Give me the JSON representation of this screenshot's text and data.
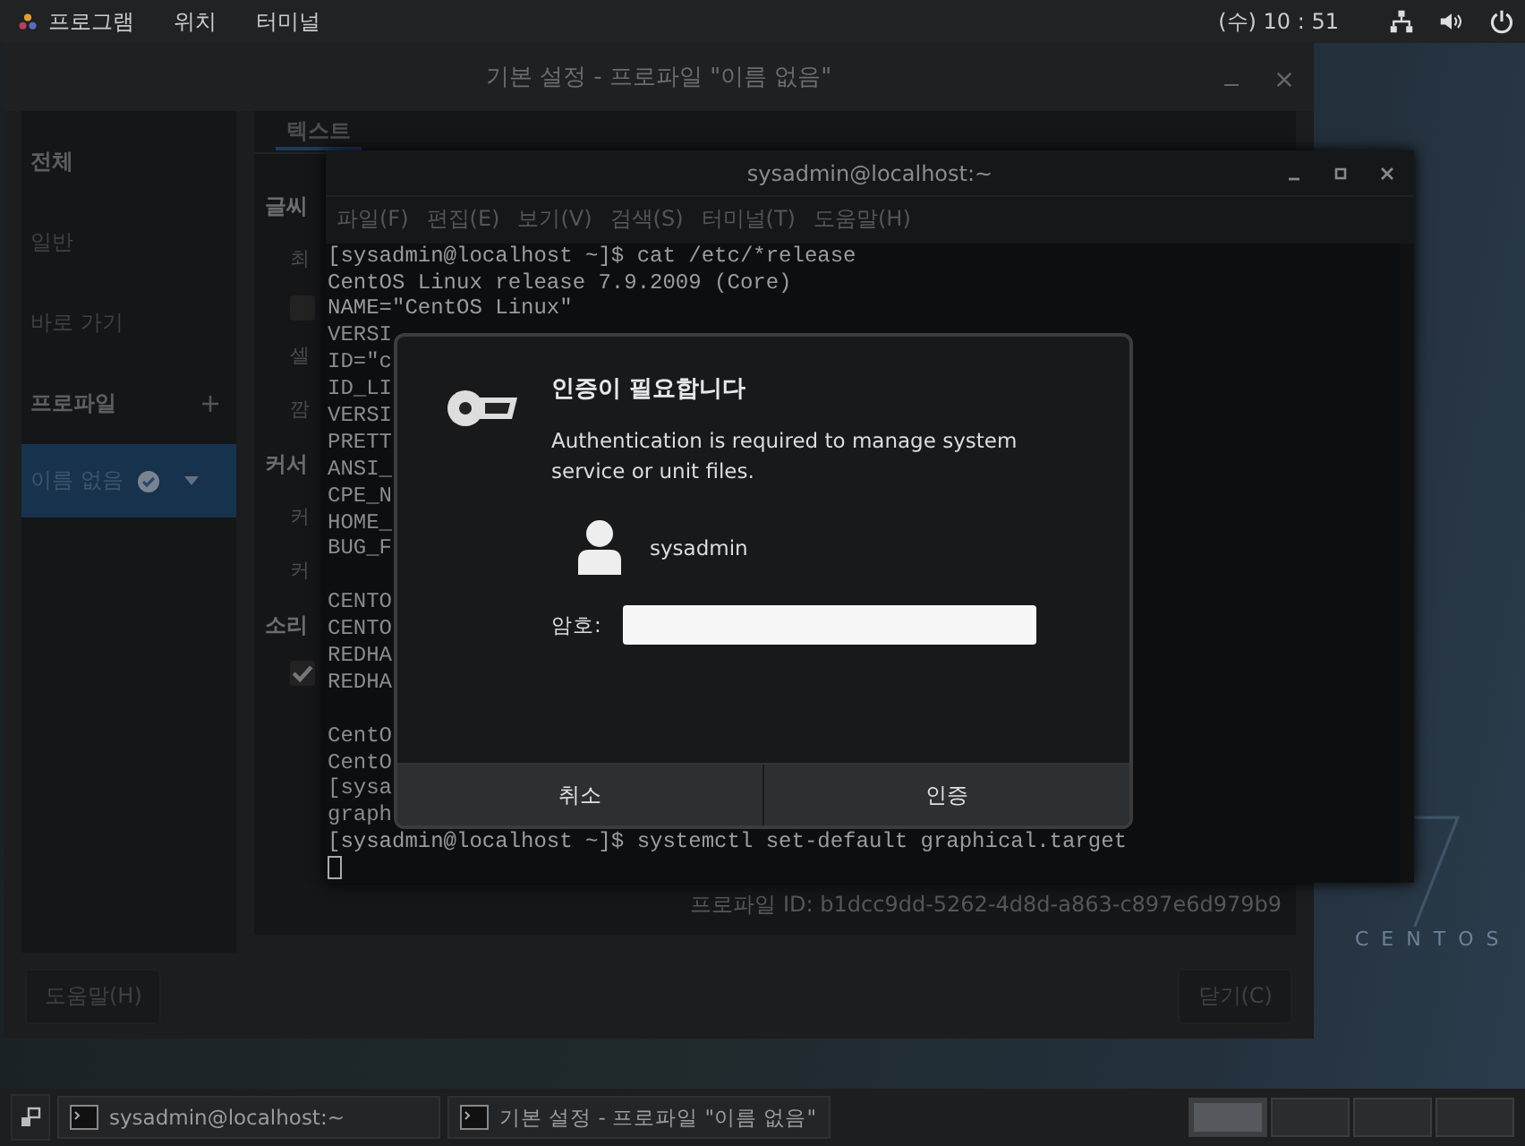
{
  "top_bar": {
    "menus": [
      "프로그램",
      "위치",
      "터미널"
    ],
    "clock": "(수) 10 : 51"
  },
  "settings_window": {
    "title": "기본 설정 - 프로파일 \"이름 없음\"",
    "sidebar": [
      {
        "kind": "header",
        "label": "전체",
        "selected": false
      },
      {
        "kind": "item",
        "label": "일반",
        "selected": false
      },
      {
        "kind": "item",
        "label": "바로 가기",
        "selected": false
      },
      {
        "kind": "header-add",
        "label": "프로파일",
        "selected": false
      },
      {
        "kind": "profile",
        "label": "이름 없음",
        "selected": true
      }
    ],
    "tabs": [
      {
        "label": "텍스트",
        "selected": true
      }
    ],
    "form_items": [
      {
        "kind": "heading",
        "text": "글씨"
      },
      {
        "kind": "label",
        "text": "최"
      },
      {
        "kind": "checkbox",
        "checked": false
      },
      {
        "kind": "label",
        "text": "셀"
      },
      {
        "kind": "label",
        "text": "깜"
      },
      {
        "kind": "heading",
        "text": "커서"
      },
      {
        "kind": "label",
        "text": "커"
      },
      {
        "kind": "label",
        "text": "커"
      },
      {
        "kind": "heading",
        "text": "소리"
      },
      {
        "kind": "checkbox",
        "checked": true
      }
    ],
    "profile_id": "프로파일 ID: b1dcc9dd-5262-4d8d-a863-c897e6d979b9",
    "help_button": "도움말(H)",
    "close_button": "닫기(C)"
  },
  "terminal_window": {
    "title": "sysadmin@localhost:~",
    "menus": [
      "파일(F)",
      "편집(E)",
      "보기(V)",
      "검색(S)",
      "터미널(T)",
      "도움말(H)"
    ],
    "lines": [
      {
        "kind": "text",
        "text": "[sysadmin@localhost ~]$ cat /etc/*release"
      },
      {
        "kind": "text",
        "text": "CentOS Linux release 7.9.2009 (Core)"
      },
      {
        "kind": "text",
        "text": "NAME=\"CentOS Linux\""
      },
      {
        "kind": "text",
        "text": "VERSI"
      },
      {
        "kind": "text",
        "text": "ID=\"c"
      },
      {
        "kind": "text",
        "text": "ID_LI"
      },
      {
        "kind": "text",
        "text": "VERSI"
      },
      {
        "kind": "text",
        "text": "PRETT"
      },
      {
        "kind": "text",
        "text": "ANSI_"
      },
      {
        "kind": "text",
        "text": "CPE_N"
      },
      {
        "kind": "text",
        "text": "HOME_"
      },
      {
        "kind": "text",
        "text": "BUG_F"
      },
      {
        "kind": "blank"
      },
      {
        "kind": "text",
        "text": "CENTO"
      },
      {
        "kind": "text",
        "text": "CENTO"
      },
      {
        "kind": "text",
        "text": "REDHA"
      },
      {
        "kind": "text",
        "text": "REDHA"
      },
      {
        "kind": "blank"
      },
      {
        "kind": "text",
        "text": "CentO"
      },
      {
        "kind": "text",
        "text": "CentO"
      },
      {
        "kind": "text",
        "text": "[sysa"
      },
      {
        "kind": "text",
        "text": "graph"
      },
      {
        "kind": "text",
        "text": "[sysadmin@localhost ~]$ systemctl set-default graphical.target"
      }
    ]
  },
  "auth_dialog": {
    "title": "인증이 필요합니다",
    "message": "Authentication is required to manage system service or unit files.",
    "user": "sysadmin",
    "password_label": "암호:",
    "buttons": [
      "취소",
      "인증"
    ]
  },
  "desktop": {
    "logo_text": "CENTOS"
  },
  "taskbar": {
    "windows": [
      {
        "label": "sysadmin@localhost:~"
      },
      {
        "label": "기본 설정 - 프로파일 \"이름 없음\""
      }
    ],
    "workspaces": [
      {
        "selected": true
      },
      {
        "selected": false
      },
      {
        "selected": false
      },
      {
        "selected": false
      }
    ]
  }
}
